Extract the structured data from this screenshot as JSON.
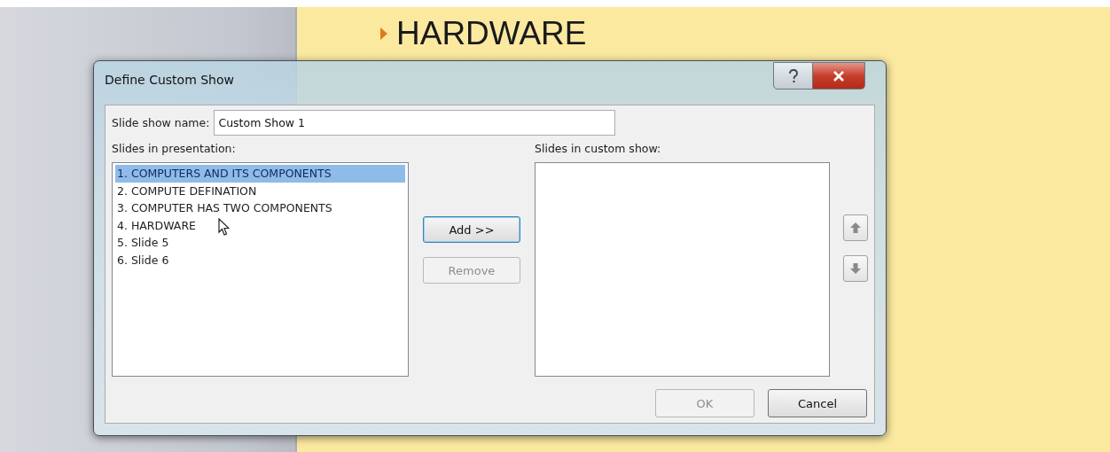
{
  "slide": {
    "bullets": [
      {
        "text": "HARDWARE"
      }
    ]
  },
  "dialog": {
    "title": "Define Custom Show",
    "name_field": {
      "label": "Slide show name:",
      "value": "Custom Show 1"
    },
    "presentation_list": {
      "label": "Slides in presentation:",
      "items": [
        {
          "text": "1. COMPUTERS AND ITS COMPONENTS",
          "selected": true
        },
        {
          "text": "2. COMPUTE DEFINATION",
          "selected": false
        },
        {
          "text": "3. COMPUTER HAS TWO COMPONENTS",
          "selected": false
        },
        {
          "text": "4. HARDWARE",
          "selected": false
        },
        {
          "text": "5. Slide 5",
          "selected": false
        },
        {
          "text": "6. Slide 6",
          "selected": false
        }
      ]
    },
    "transfer_buttons": [
      {
        "label": "Add >>",
        "disabled": false,
        "focused": true
      },
      {
        "label": "Remove",
        "disabled": true,
        "focused": false
      }
    ],
    "custom_show_list": {
      "label": "Slides in custom show:"
    },
    "footer_buttons": [
      {
        "label": "OK",
        "disabled": true,
        "focused": false
      },
      {
        "label": "Cancel",
        "disabled": false,
        "focused": false
      }
    ]
  }
}
